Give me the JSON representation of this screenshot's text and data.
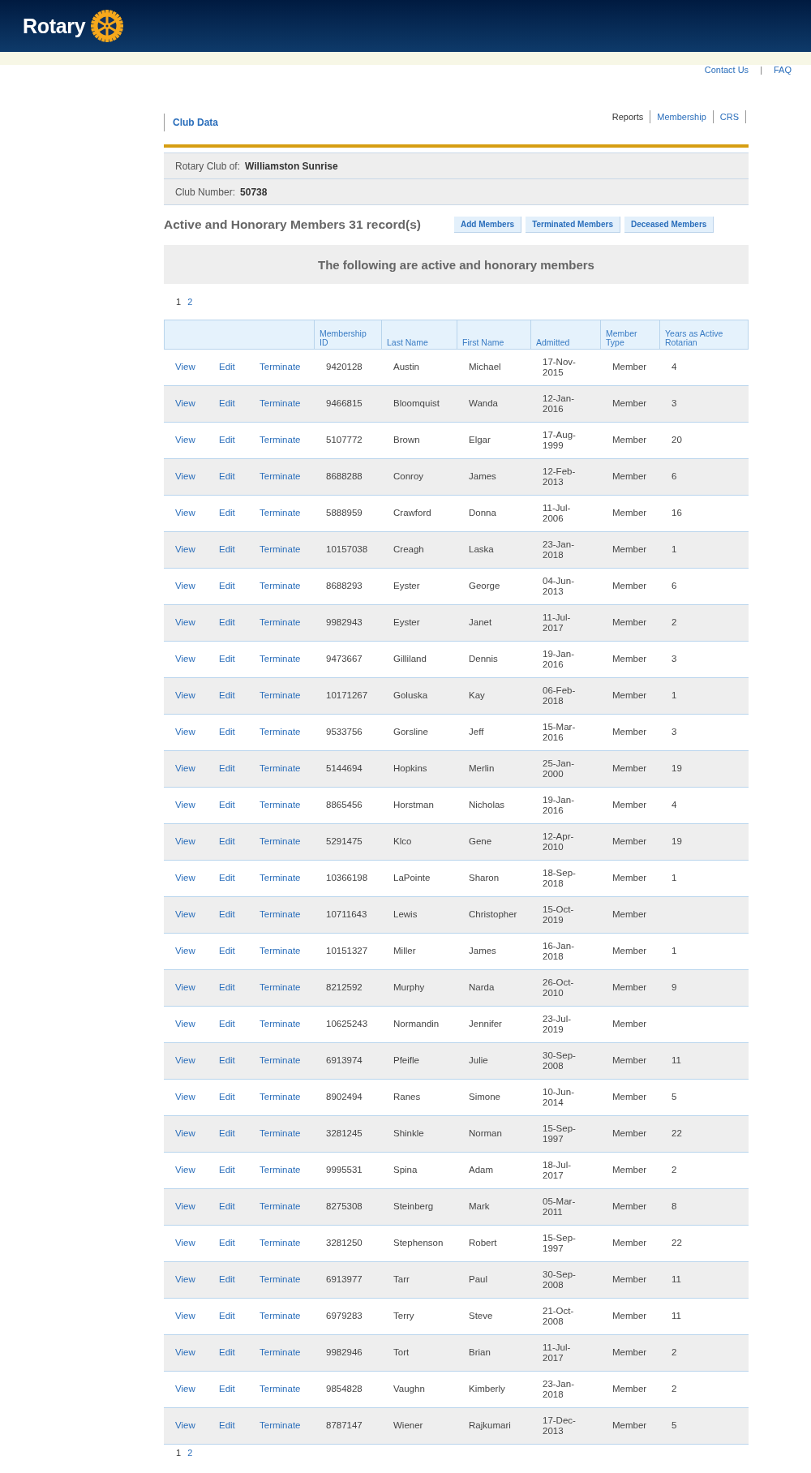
{
  "header": {
    "logo_text": "Rotary"
  },
  "top_links": [
    {
      "label": "Contact Us"
    },
    {
      "label": "|",
      "kind": "separator"
    },
    {
      "label": "FAQ"
    }
  ],
  "section_title": "Club Data",
  "nav_tabs": [
    {
      "label": "Reports",
      "selected": true
    },
    {
      "label": "Membership",
      "selected": false
    },
    {
      "label": "CRS",
      "selected": false
    }
  ],
  "club_info": [
    {
      "label": "Rotary Club of:",
      "value": "Williamston Sunrise"
    },
    {
      "label": "Club Number:",
      "value": "50738"
    }
  ],
  "heading": "Active and Honorary Members 31 record(s)",
  "action_buttons": [
    "Add Members",
    "Terminated Members",
    "Deceased Members"
  ],
  "banner": "The following are active and honorary members",
  "pagination_top": [
    {
      "label": "1",
      "selected": true
    },
    {
      "label": "2",
      "selected": false
    }
  ],
  "table": {
    "columns": [
      "Membership ID",
      "Last Name",
      "First Name",
      "Admitted",
      "Member Type",
      "Years as Active Rotarian"
    ],
    "rows": [
      {
        "actions": [
          "View",
          "Edit",
          "Terminate"
        ],
        "id": "9420128",
        "last": "Austin",
        "first": "Michael",
        "admitted": "17-Nov-2015",
        "type": "Member",
        "years": "4"
      },
      {
        "actions": [
          "View",
          "Edit",
          "Terminate"
        ],
        "id": "9466815",
        "last": "Bloomquist",
        "first": "Wanda",
        "admitted": "12-Jan-2016",
        "type": "Member",
        "years": "3"
      },
      {
        "actions": [
          "View",
          "Edit",
          "Terminate"
        ],
        "id": "5107772",
        "last": "Brown",
        "first": "Elgar",
        "admitted": "17-Aug-1999",
        "type": "Member",
        "years": "20"
      },
      {
        "actions": [
          "View",
          "Edit",
          "Terminate"
        ],
        "id": "8688288",
        "last": "Conroy",
        "first": "James",
        "admitted": "12-Feb-2013",
        "type": "Member",
        "years": "6"
      },
      {
        "actions": [
          "View",
          "Edit",
          "Terminate"
        ],
        "id": "5888959",
        "last": "Crawford",
        "first": "Donna",
        "admitted": "11-Jul-2006",
        "type": "Member",
        "years": "16"
      },
      {
        "actions": [
          "View",
          "Edit",
          "Terminate"
        ],
        "id": "10157038",
        "last": "Creagh",
        "first": "Laska",
        "admitted": "23-Jan-2018",
        "type": "Member",
        "years": "1"
      },
      {
        "actions": [
          "View",
          "Edit",
          "Terminate"
        ],
        "id": "8688293",
        "last": "Eyster",
        "first": "George",
        "admitted": "04-Jun-2013",
        "type": "Member",
        "years": "6"
      },
      {
        "actions": [
          "View",
          "Edit",
          "Terminate"
        ],
        "id": "9982943",
        "last": "Eyster",
        "first": "Janet",
        "admitted": "11-Jul-2017",
        "type": "Member",
        "years": "2"
      },
      {
        "actions": [
          "View",
          "Edit",
          "Terminate"
        ],
        "id": "9473667",
        "last": "Gilliland",
        "first": "Dennis",
        "admitted": "19-Jan-2016",
        "type": "Member",
        "years": "3"
      },
      {
        "actions": [
          "View",
          "Edit",
          "Terminate"
        ],
        "id": "10171267",
        "last": "Goluska",
        "first": "Kay",
        "admitted": "06-Feb-2018",
        "type": "Member",
        "years": "1"
      },
      {
        "actions": [
          "View",
          "Edit",
          "Terminate"
        ],
        "id": "9533756",
        "last": "Gorsline",
        "first": "Jeff",
        "admitted": "15-Mar-2016",
        "type": "Member",
        "years": "3"
      },
      {
        "actions": [
          "View",
          "Edit",
          "Terminate"
        ],
        "id": "5144694",
        "last": "Hopkins",
        "first": "Merlin",
        "admitted": "25-Jan-2000",
        "type": "Member",
        "years": "19"
      },
      {
        "actions": [
          "View",
          "Edit",
          "Terminate"
        ],
        "id": "8865456",
        "last": "Horstman",
        "first": "Nicholas",
        "admitted": "19-Jan-2016",
        "type": "Member",
        "years": "4"
      },
      {
        "actions": [
          "View",
          "Edit",
          "Terminate"
        ],
        "id": "5291475",
        "last": "Klco",
        "first": "Gene",
        "admitted": "12-Apr-2010",
        "type": "Member",
        "years": "19"
      },
      {
        "actions": [
          "View",
          "Edit",
          "Terminate"
        ],
        "id": "10366198",
        "last": "LaPointe",
        "first": "Sharon",
        "admitted": "18-Sep-2018",
        "type": "Member",
        "years": "1"
      },
      {
        "actions": [
          "View",
          "Edit",
          "Terminate"
        ],
        "id": "10711643",
        "last": "Lewis",
        "first": "Christopher",
        "admitted": "15-Oct-2019",
        "type": "Member"
      },
      {
        "actions": [
          "View",
          "Edit",
          "Terminate"
        ],
        "id": "10151327",
        "last": "Miller",
        "first": "James",
        "admitted": "16-Jan-2018",
        "type": "Member",
        "years": "1"
      },
      {
        "actions": [
          "View",
          "Edit",
          "Terminate"
        ],
        "id": "8212592",
        "last": "Murphy",
        "first": "Narda",
        "admitted": "26-Oct-2010",
        "type": "Member",
        "years": "9"
      },
      {
        "actions": [
          "View",
          "Edit",
          "Terminate"
        ],
        "id": "10625243",
        "last": "Normandin",
        "first": "Jennifer",
        "admitted": "23-Jul-2019",
        "type": "Member"
      },
      {
        "actions": [
          "View",
          "Edit",
          "Terminate"
        ],
        "id": "6913974",
        "last": "Pfeifle",
        "first": "Julie",
        "admitted": "30-Sep-2008",
        "type": "Member",
        "years": "11"
      },
      {
        "actions": [
          "View",
          "Edit",
          "Terminate"
        ],
        "id": "8902494",
        "last": "Ranes",
        "first": "Simone",
        "admitted": "10-Jun-2014",
        "type": "Member",
        "years": "5"
      },
      {
        "actions": [
          "View",
          "Edit",
          "Terminate"
        ],
        "id": "3281245",
        "last": "Shinkle",
        "first": "Norman",
        "admitted": "15-Sep-1997",
        "type": "Member",
        "years": "22"
      },
      {
        "actions": [
          "View",
          "Edit",
          "Terminate"
        ],
        "id": "9995531",
        "last": "Spina",
        "first": "Adam",
        "admitted": "18-Jul-2017",
        "type": "Member",
        "years": "2"
      },
      {
        "actions": [
          "View",
          "Edit",
          "Terminate"
        ],
        "id": "8275308",
        "last": "Steinberg",
        "first": "Mark",
        "admitted": "05-Mar-2011",
        "type": "Member",
        "years": "8"
      },
      {
        "actions": [
          "View",
          "Edit",
          "Terminate"
        ],
        "id": "3281250",
        "last": "Stephenson",
        "first": "Robert",
        "admitted": "15-Sep-1997",
        "type": "Member",
        "years": "22"
      },
      {
        "actions": [
          "View",
          "Edit",
          "Terminate"
        ],
        "id": "6913977",
        "last": "Tarr",
        "first": "Paul",
        "admitted": "30-Sep-2008",
        "type": "Member",
        "years": "11"
      },
      {
        "actions": [
          "View",
          "Edit",
          "Terminate"
        ],
        "id": "6979283",
        "last": "Terry",
        "first": "Steve",
        "admitted": "21-Oct-2008",
        "type": "Member",
        "years": "11"
      },
      {
        "actions": [
          "View",
          "Edit",
          "Terminate"
        ],
        "id": "9982946",
        "last": "Tort",
        "first": "Brian",
        "admitted": "11-Jul-2017",
        "type": "Member",
        "years": "2"
      },
      {
        "actions": [
          "View",
          "Edit",
          "Terminate"
        ],
        "id": "9854828",
        "last": "Vaughn",
        "first": "Kimberly",
        "admitted": "23-Jan-2018",
        "type": "Member",
        "years": "2"
      },
      {
        "actions": [
          "View",
          "Edit",
          "Terminate"
        ],
        "id": "8787147",
        "last": "Wiener",
        "first": "Rajkumari",
        "admitted": "17-Dec-2013",
        "type": "Member",
        "years": "5"
      }
    ]
  },
  "pagination_bottom": [
    {
      "label": "1",
      "selected": true
    },
    {
      "label": "2",
      "selected": false
    }
  ]
}
